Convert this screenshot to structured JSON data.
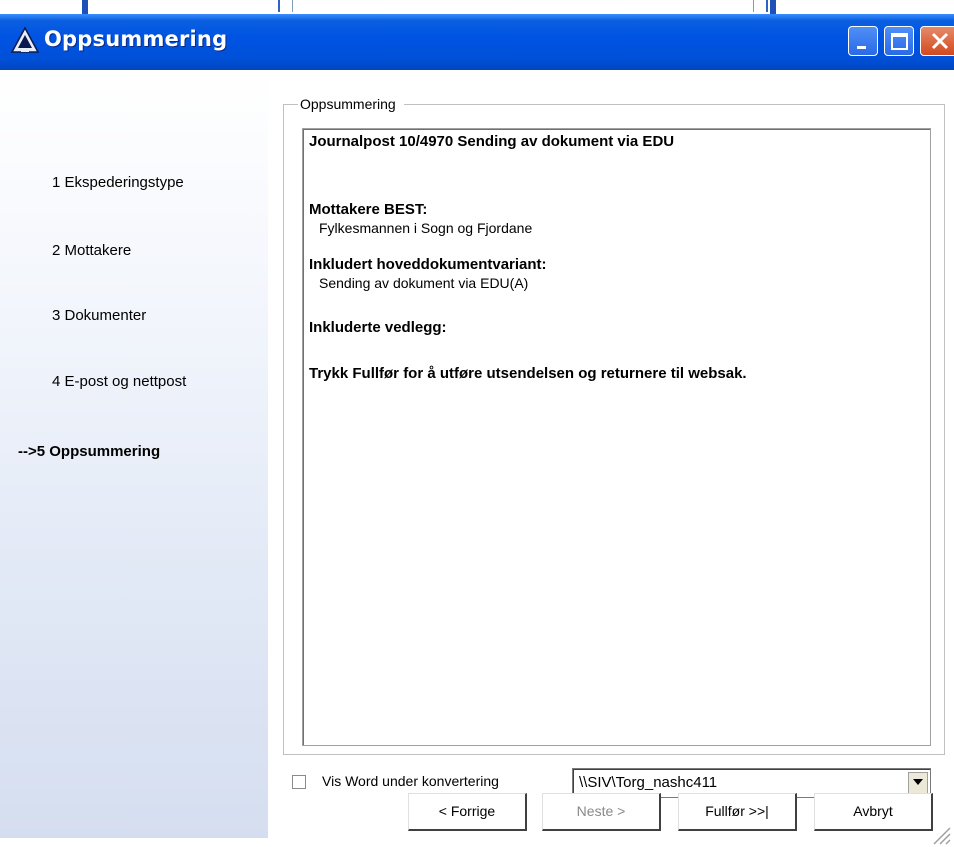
{
  "window": {
    "title": "Oppsummering"
  },
  "steps": [
    {
      "label": "1 Ekspederingstype"
    },
    {
      "label": "2 Mottakere"
    },
    {
      "label": "3 Dokumenter"
    },
    {
      "label": "4 E-post og nettpost"
    },
    {
      "label": "-->5 Oppsummering",
      "active": true
    }
  ],
  "summary": {
    "group_label": "Oppsummering",
    "heading": "Journalpost 10/4970 Sending av dokument via EDU",
    "recipients_heading": "Mottakere BEST:",
    "recipients": "Fylkesmannen i Sogn og Fjordane",
    "main_doc_heading": "Inkludert hoveddokumentvariant:",
    "main_doc": "Sending av dokument via EDU(A)",
    "attachments_heading": "Inkluderte vedlegg:",
    "instruction": "Trykk Fullfør for å utføre utsendelsen og returnere til websak."
  },
  "options": {
    "show_word_label": "Vis Word under konvertering",
    "show_word_checked": false,
    "printer_value": "\\\\SIV\\Torg_nashc411"
  },
  "buttons": {
    "back": "< Forrige",
    "next": "Neste >",
    "finish": "Fullfør >>|",
    "cancel": "Avbryt"
  }
}
